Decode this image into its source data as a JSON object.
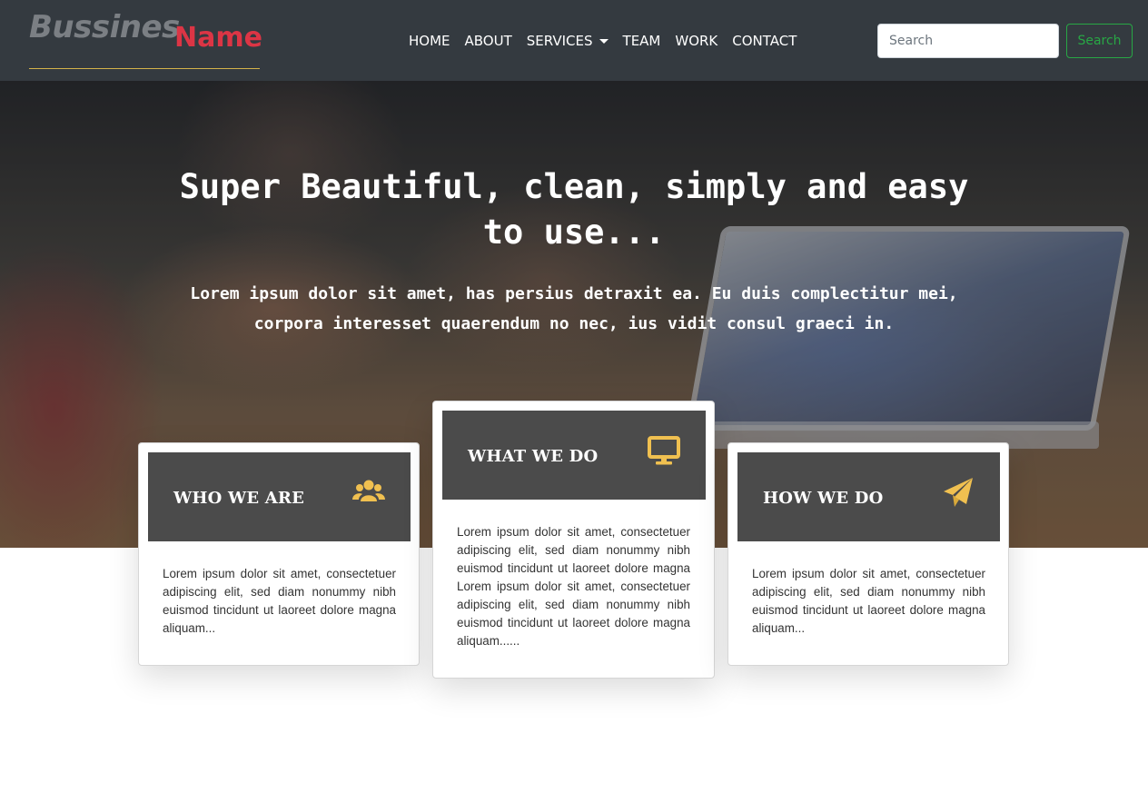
{
  "brand": {
    "first": "Bussines",
    "second": "Name"
  },
  "nav": {
    "items": [
      {
        "label": "HOME"
      },
      {
        "label": "ABOUT"
      },
      {
        "label": "SERVICES"
      },
      {
        "label": "TEAM"
      },
      {
        "label": "WORK"
      },
      {
        "label": "CONTACT"
      }
    ]
  },
  "search": {
    "placeholder": "Search",
    "button_label": "Search"
  },
  "hero": {
    "title": "Super Beautiful, clean, simply and easy to use...",
    "subtitle": "Lorem ipsum dolor sit amet, has persius detraxit ea. Eu duis complectitur mei, corpora interesset quaerendum no nec, ius vidit consul graeci in."
  },
  "cards": [
    {
      "title": "WHO WE ARE",
      "icon": "users-icon",
      "text": "Lorem ipsum dolor sit amet, consectetuer adipiscing elit, sed diam nonummy nibh euismod tincidunt ut laoreet dolore magna aliquam..."
    },
    {
      "title": "WHAT WE DO",
      "icon": "desktop-icon",
      "text": "Lorem ipsum dolor sit amet, consectetuer adipiscing elit, sed diam nonummy nibh euismod tincidunt ut laoreet dolore magna Lorem ipsum dolor sit amet, consectetuer adipiscing elit, sed diam nonummy nibh euismod tincidunt ut laoreet dolore magna aliquam......"
    },
    {
      "title": "HOW WE DO",
      "icon": "paper-plane-icon",
      "text": "Lorem ipsum dolor sit amet, consectetuer adipiscing elit, sed diam nonummy nibh euismod tincidunt ut laoreet dolore magna aliquam..."
    }
  ],
  "colors": {
    "navbar": "#343a40",
    "brand_accent": "#dc3545",
    "search_button": "#28a745",
    "card_header": "#4b4b4b",
    "icon_accent": "#f0c050"
  }
}
